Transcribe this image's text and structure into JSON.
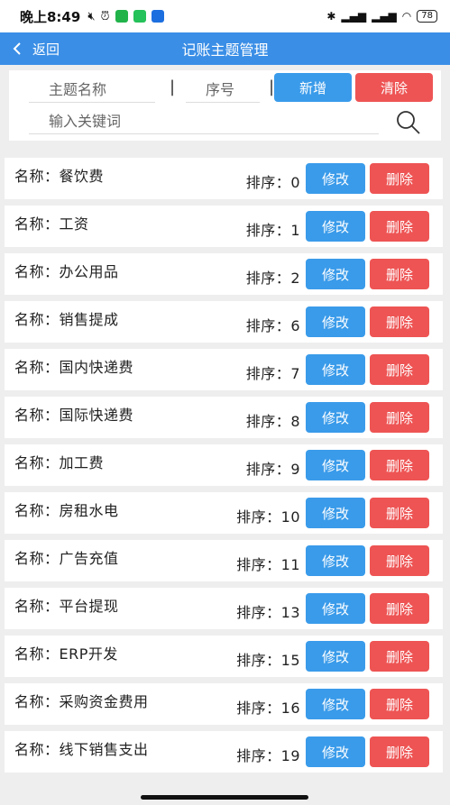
{
  "status_bar": {
    "time": "晚上8:49",
    "battery": "78"
  },
  "nav": {
    "back_label": "返回",
    "title": "记账主题管理"
  },
  "form": {
    "name_placeholder": "主题名称",
    "order_placeholder": "序号",
    "add_label": "新增",
    "clear_label": "清除",
    "keyword_placeholder": "输入关键词"
  },
  "row_labels": {
    "name_prefix": "名称：",
    "order_prefix": "排序：",
    "edit_label": "修改",
    "delete_label": "删除"
  },
  "items": [
    {
      "name": "餐饮费",
      "order": "0"
    },
    {
      "name": "工资",
      "order": "1"
    },
    {
      "name": "办公用品",
      "order": "2"
    },
    {
      "name": "销售提成",
      "order": "6"
    },
    {
      "name": "国内快递费",
      "order": "7"
    },
    {
      "name": "国际快递费",
      "order": "8"
    },
    {
      "name": "加工费",
      "order": "9"
    },
    {
      "name": "房租水电",
      "order": "10"
    },
    {
      "name": "广告充值",
      "order": "11"
    },
    {
      "name": "平台提现",
      "order": "13"
    },
    {
      "name": "ERP开发",
      "order": "15"
    },
    {
      "name": "采购资金费用",
      "order": "16"
    },
    {
      "name": "线下销售支出",
      "order": "19"
    }
  ],
  "colors": {
    "primary": "#3a8ee6",
    "button_blue": "#3a9bea",
    "button_red": "#ee5454"
  }
}
